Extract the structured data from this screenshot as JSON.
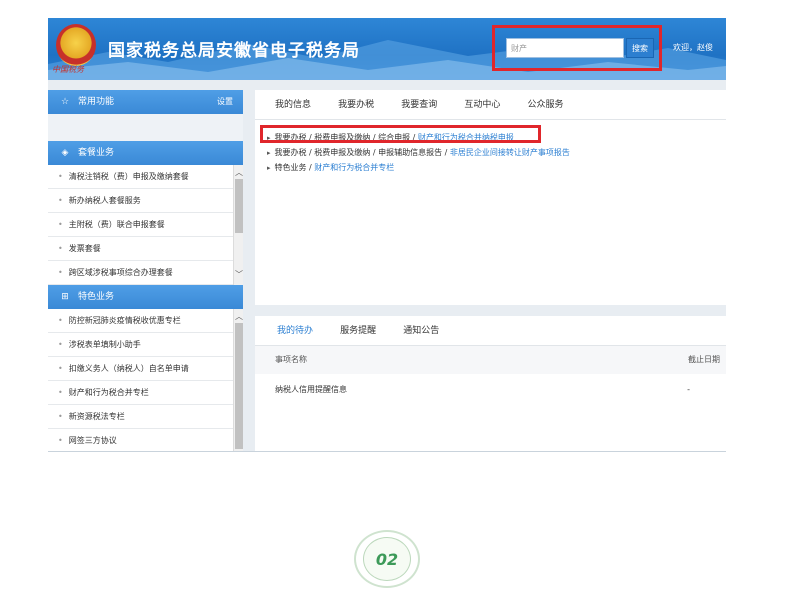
{
  "header": {
    "title": "国家税务总局安徽省电子税务局",
    "emblem_text": "中国税务",
    "search_value": "财产",
    "search_button": "搜索",
    "welcome": "欢迎，赵俊"
  },
  "sidebar": {
    "common_label": "常用功能",
    "settings_label": "设置",
    "package_label": "套餐业务",
    "package_items": [
      "清税注销税（费）申报及缴纳套餐",
      "新办纳税人套餐服务",
      "主附税（费）联合申报套餐",
      "发票套餐",
      "跨区域涉税事项综合办理套餐"
    ],
    "special_label": "特色业务",
    "special_items": [
      "防控新冠肺炎疫情税收优惠专栏",
      "涉税表单填制小助手",
      "扣缴义务人（纳税人）自名单申请",
      "财产和行为税合并专栏",
      "新资源税法专栏",
      "网签三方协议"
    ]
  },
  "main": {
    "tabs": [
      "我的信息",
      "我要办税",
      "我要查询",
      "互动中心",
      "公众服务"
    ],
    "links": [
      {
        "path": "我要办税 / 税费申报及缴纳 / 综合申报 / ",
        "target": "财产和行为税合并纳税申报"
      },
      {
        "path": "我要办税 / 税费申报及缴纳 / 申报辅助信息报告 / ",
        "target": "非居民企业间接转让财产事项报告"
      },
      {
        "path": "特色业务 / ",
        "target": "财产和行为税合并专栏"
      }
    ]
  },
  "lower": {
    "tabs": [
      "我的待办",
      "服务提醒",
      "通知公告"
    ],
    "col_item": "事项名称",
    "col_deadline": "截止日期",
    "row_item": "纳税人信用提醒信息",
    "row_deadline": "-"
  },
  "badge": {
    "number": "02"
  },
  "colors": {
    "accent": "#2c7fd2",
    "highlight_border": "#e0262b",
    "header_blue": "#1f72c4"
  }
}
